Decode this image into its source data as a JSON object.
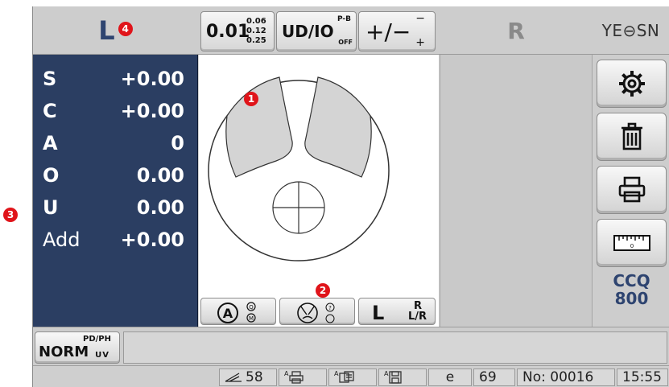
{
  "callouts": [
    "1",
    "2",
    "3",
    "4"
  ],
  "top_bar": {
    "left_side_label": "L",
    "precision_button": {
      "main": "0.01",
      "options": [
        "0.06",
        "0.12",
        "0.25"
      ]
    },
    "udio_button": {
      "main": "UD/IO",
      "sup": "P-B",
      "sub": "OFF"
    },
    "sign_button": {
      "main": "+/−",
      "sup": "−",
      "sub": "+"
    },
    "right_side_label": "R",
    "brand": "YE⊖SN"
  },
  "readings": [
    {
      "label": "S",
      "value": "+0.00"
    },
    {
      "label": "C",
      "value": "+0.00"
    },
    {
      "label": "A",
      "value": "0"
    },
    {
      "label": "O",
      "value": "0.00"
    },
    {
      "label": "U",
      "value": "0.00"
    },
    {
      "label": "Add",
      "value": "+0.00"
    }
  ],
  "mode_bar": {
    "side_select": {
      "main": "L",
      "top": "R",
      "bottom": "L/R"
    }
  },
  "model": {
    "line1": "CCQ",
    "line2": "800"
  },
  "mode_strip": {
    "norm_button": {
      "main": "NORM",
      "sup": "PD/PH",
      "sub": "UV"
    }
  },
  "status_bar": {
    "prism_count": "58",
    "prefix_a": "A",
    "e_label": "e",
    "count": "69",
    "record_no": "No: 00016",
    "time": "15:55"
  },
  "colors": {
    "panel_navy": "#2b3e62",
    "lens_gray": "#d4d4d4",
    "marker_red": "#e0141a",
    "model_blue": "#2e4470"
  }
}
